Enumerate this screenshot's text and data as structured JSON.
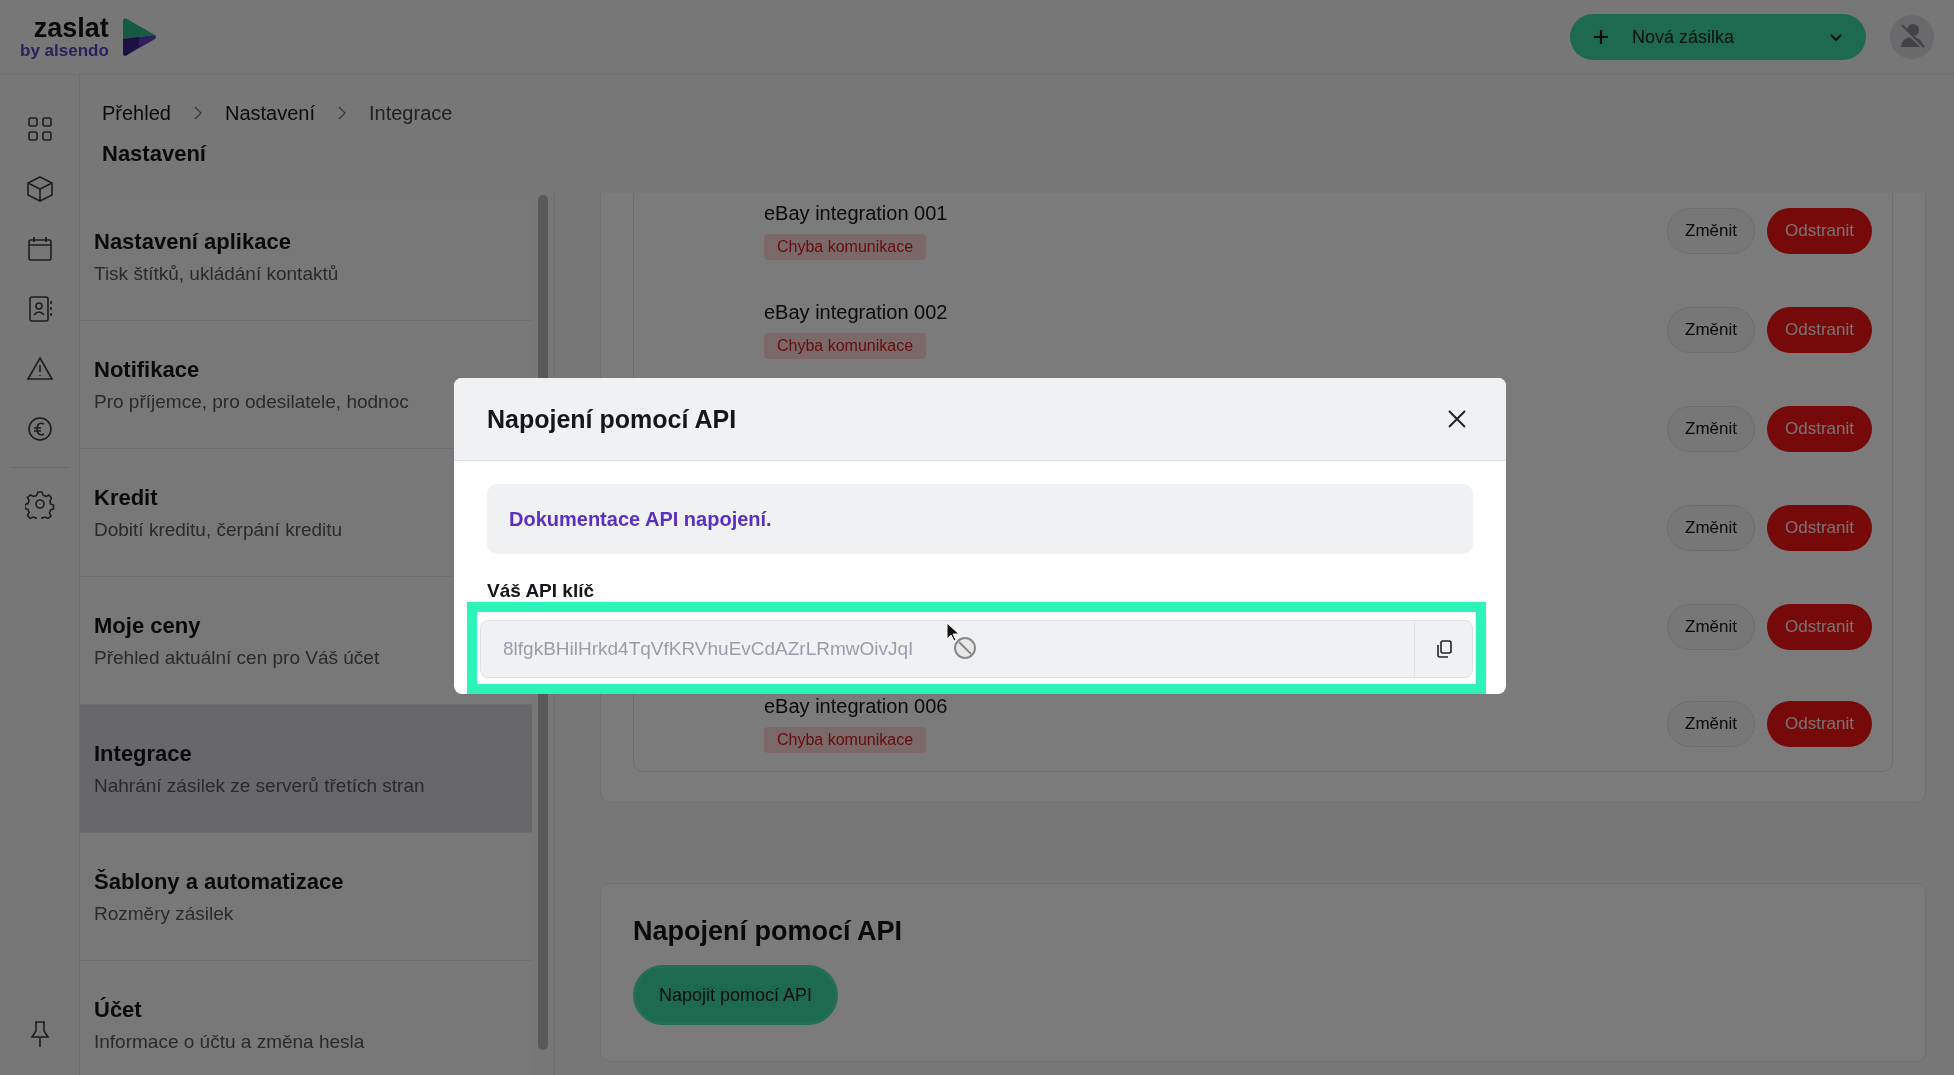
{
  "header": {
    "logo_word": "zaslat",
    "logo_tagline": "by alsendo",
    "new_button": "Nová zásilka"
  },
  "rail": [
    {
      "kind": "grid"
    },
    {
      "kind": "box"
    },
    {
      "kind": "calendar"
    },
    {
      "kind": "contacts"
    },
    {
      "kind": "warning"
    },
    {
      "kind": "euro"
    },
    {
      "kind": "divider"
    },
    {
      "kind": "gear"
    }
  ],
  "breadcrumb": [
    "Přehled",
    "Nastavení",
    "Integrace"
  ],
  "page_title": "Nastavení",
  "settings_menu": [
    {
      "title": "Nastavení aplikace",
      "subtitle": "Tisk štítků, ukládání kontaktů",
      "selected": false
    },
    {
      "title": "Notifikace",
      "subtitle": "Pro příjemce, pro odesilatele, hodnoc",
      "selected": false
    },
    {
      "title": "Kredit",
      "subtitle": "Dobití kreditu, čerpání kreditu",
      "selected": false
    },
    {
      "title": "Moje ceny",
      "subtitle": "Přehled aktuální cen pro Váš účet",
      "selected": false
    },
    {
      "title": "Integrace",
      "subtitle": "Nahrání zásilek ze serverů třetích stran",
      "selected": true
    },
    {
      "title": "Šablony a automatizace",
      "subtitle": "Rozměry zásilek",
      "selected": false
    },
    {
      "title": "Účet",
      "subtitle": "Informace o účtu a změna hesla",
      "selected": false
    }
  ],
  "integrations": [
    {
      "name": "eBay integration 001",
      "status": "Chyba komunikace",
      "edit": "Změnit",
      "delete": "Odstranit"
    },
    {
      "name": "eBay integration 002",
      "status": "Chyba komunikace",
      "edit": "Změnit",
      "delete": "Odstranit"
    },
    {
      "edit": "Změnit",
      "delete": "Odstranit"
    },
    {
      "edit": "Změnit",
      "delete": "Odstranit"
    },
    {
      "edit": "Změnit",
      "delete": "Odstranit"
    },
    {
      "name": "eBay integration 006",
      "status": "Chyba komunikace",
      "edit": "Změnit",
      "delete": "Odstranit"
    }
  ],
  "api_card": {
    "title": "Napojení pomocí API",
    "button": "Napojit pomocí API"
  },
  "modal": {
    "title": "Napojení pomocí API",
    "doc_link": "Dokumentace API napojení.",
    "key_label": "Váš API klíč",
    "key_value": "8lfgkBHilHrkd4TqVfKRVhuEvCdAZrLRmwOivJqI"
  }
}
